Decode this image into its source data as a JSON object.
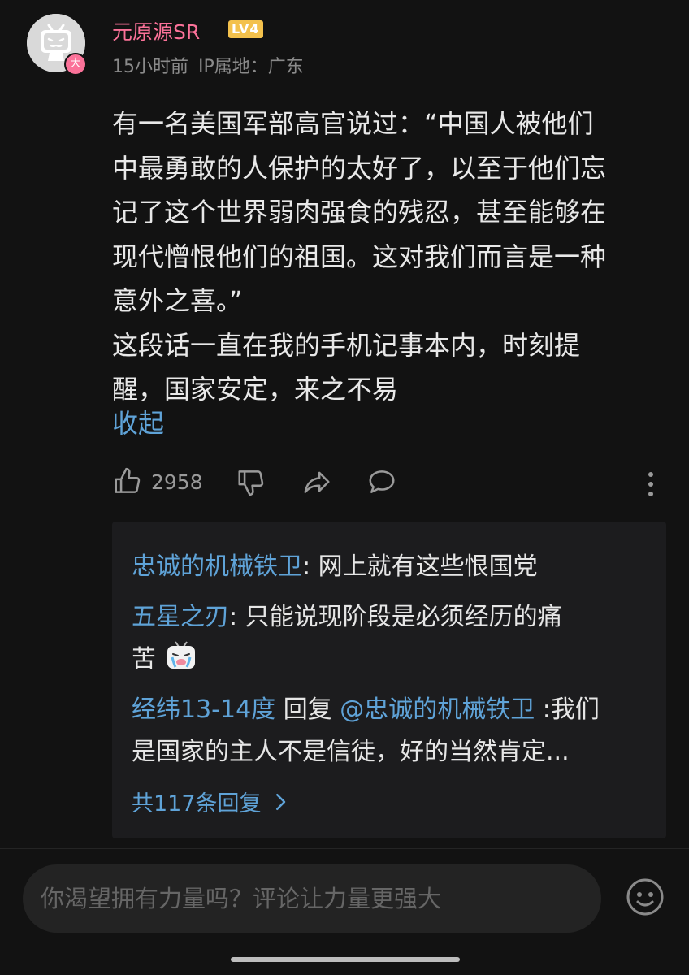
{
  "comment": {
    "username": "元原源SR",
    "level": "LV4",
    "avatar_badge": "大",
    "time": "15小时前",
    "ip_location": "IP属地：广东",
    "body_lines": [
      "有一名美国军部高官说过：“中国人被他们",
      "中最勇敢的人保护的太好了，以至于他们忘",
      "记了这个世界弱肉强食的残忍，甚至能够在",
      "现代憎恨他们的祖国。这对我们而言是一种",
      "意外之喜。”",
      "这段话一直在我的手机记事本内，时刻提",
      "醒，国家安定，来之不易"
    ],
    "collapse_label": "收起",
    "like_count": "2958",
    "icons": {
      "like": "thumbs-up-icon",
      "dislike": "thumbs-down-icon",
      "share": "share-icon",
      "reply": "comment-icon",
      "more": "more-vertical-icon"
    }
  },
  "replies": [
    {
      "user": "忠诚的机械铁卫",
      "sep": ": ",
      "text": "网上就有这些恨国党"
    },
    {
      "user": "五星之刃",
      "sep": ": ",
      "text": "只能说现阶段是必须经历的痛",
      "text2": "苦"
    },
    {
      "user": "经纬13-14度",
      "reply_word": " 回复 ",
      "mention": "@忠诚的机械铁卫",
      "sep": " :",
      "text": "我们",
      "text2": "是国家的主人不是信徒，好的当然肯定..."
    }
  ],
  "more_replies_label": "共117条回复",
  "input": {
    "placeholder": "你渴望拥有力量吗？评论让力量更强大"
  },
  "colors": {
    "accent_pink": "#fb7299",
    "link_blue": "#5fa3d8",
    "level_gold": "#f3c14c",
    "background": "#121212"
  }
}
